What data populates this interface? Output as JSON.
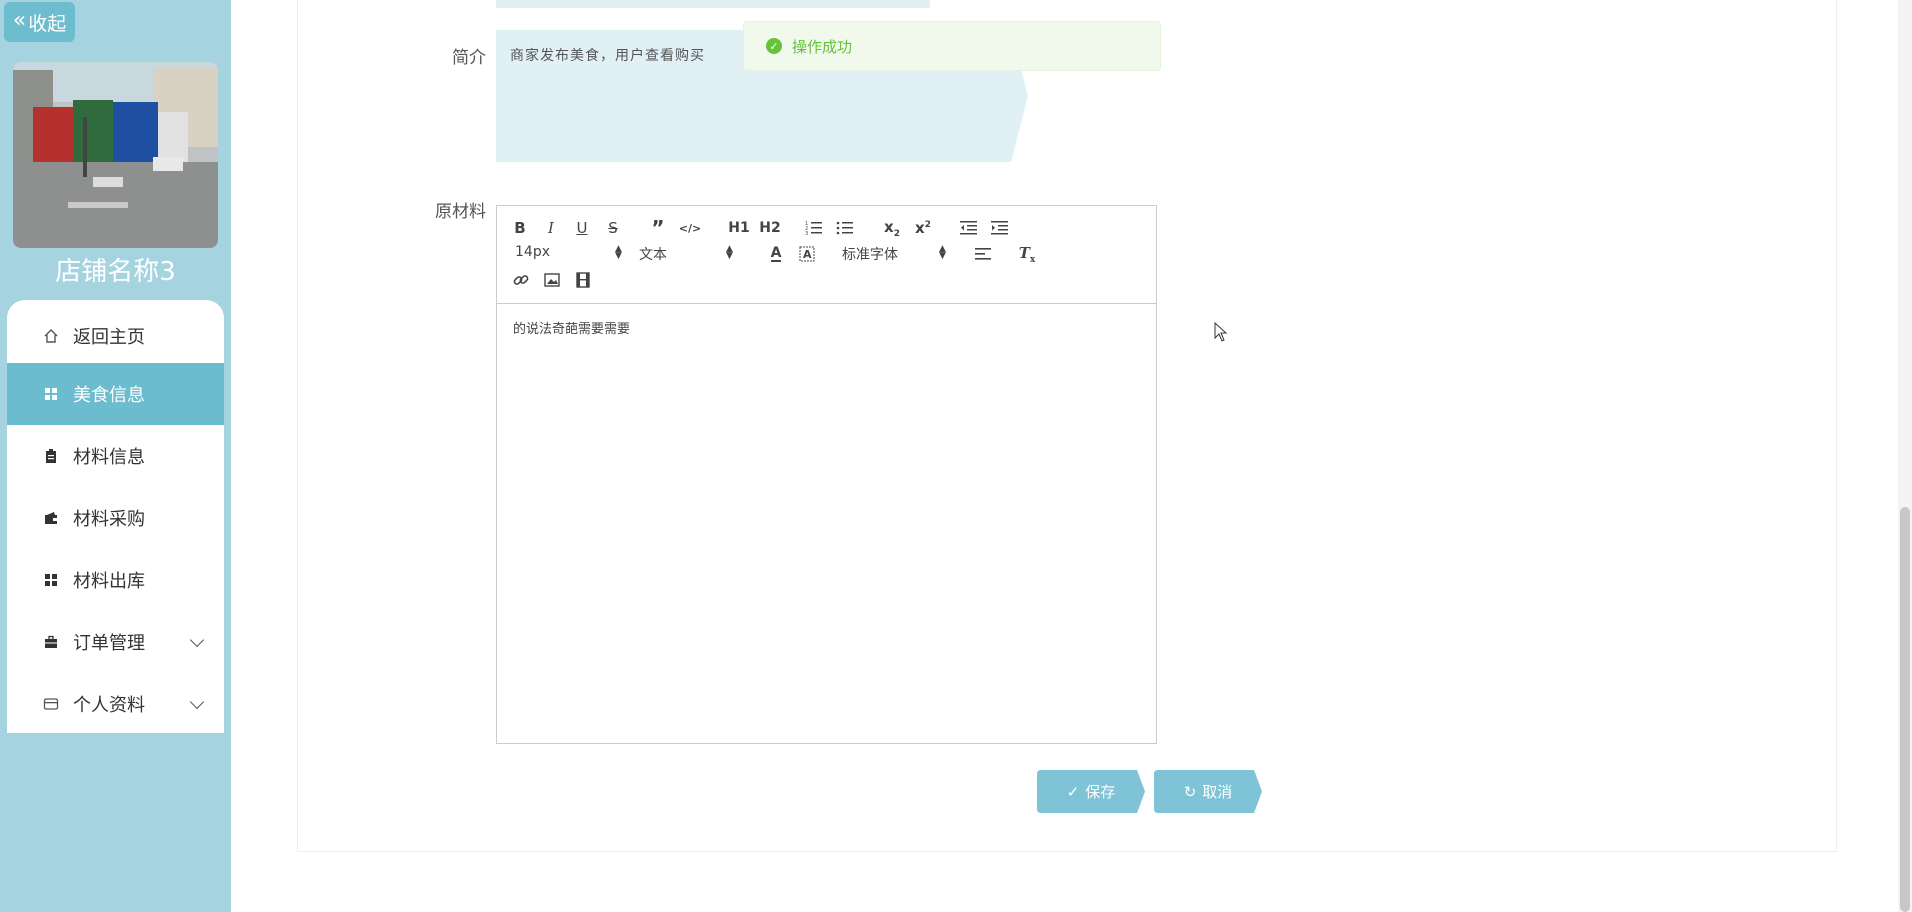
{
  "sidebar": {
    "collapse_label": "收起",
    "store_name": "店铺名称3",
    "items": [
      {
        "label": "返回主页",
        "icon": "home-icon"
      },
      {
        "label": "美食信息",
        "icon": "grid-icon",
        "active": true
      },
      {
        "label": "材料信息",
        "icon": "clipboard-icon"
      },
      {
        "label": "材料采购",
        "icon": "wallet-icon"
      },
      {
        "label": "材料出库",
        "icon": "grid-icon"
      },
      {
        "label": "订单管理",
        "icon": "briefcase-icon",
        "expandable": true
      },
      {
        "label": "个人资料",
        "icon": "card-icon",
        "expandable": true
      }
    ]
  },
  "form": {
    "intro_label": "简介",
    "intro_value": "商家发布美食，用户查看购买",
    "materials_label": "原材料",
    "editor_content": "的说法奇葩需要需要"
  },
  "toolbar": {
    "font_size": "14px",
    "block_type": "文本",
    "font_family": "标准字体",
    "h1_label": "H1",
    "h2_label": "H2"
  },
  "toast": {
    "message": "操作成功"
  },
  "buttons": {
    "save": "保存",
    "cancel": "取消"
  },
  "colors": {
    "sidebar_bg": "#a5d4e0",
    "accent": "#6bbccf",
    "button": "#7ec4d6",
    "success": "#67c23a"
  }
}
